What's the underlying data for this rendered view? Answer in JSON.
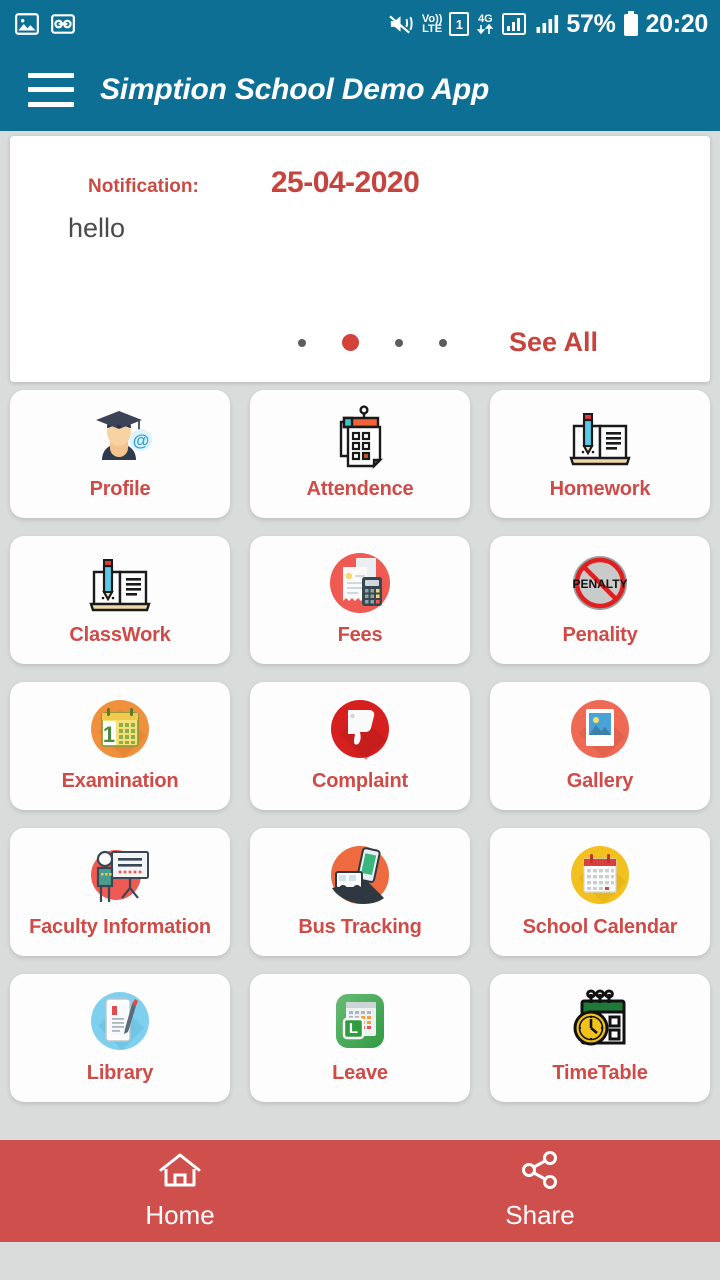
{
  "statusbar": {
    "left_icons": [
      "screenshot-icon",
      "voicemail-icon"
    ],
    "mute_icon": "mute-vibrate-icon",
    "volte_top": "Vo))",
    "volte_bottom": "LTE",
    "sim_label": "1",
    "network_type": "4G",
    "battery_percent": "57%",
    "time": "20:20"
  },
  "appbar": {
    "menu_icon": "hamburger-menu-icon",
    "title": "Simption School Demo App",
    "bg_color": "#0e6f94"
  },
  "notification": {
    "label": "Notification:",
    "date": "25-04-2020",
    "message": "hello",
    "see_all": "See All",
    "dots_count": 4,
    "active_dot_index": 1,
    "accent_color": "#c6443d"
  },
  "grid": {
    "label_color": "#cf4b47",
    "items": [
      {
        "label": "Profile",
        "icon": "graduate-avatar-icon"
      },
      {
        "label": "Attendence",
        "icon": "wall-calendar-checklist-icon"
      },
      {
        "label": "Homework",
        "icon": "book-pencil-icon"
      },
      {
        "label": "ClassWork",
        "icon": "book-pencil-icon"
      },
      {
        "label": "Fees",
        "icon": "invoice-calculator-icon"
      },
      {
        "label": "Penality",
        "icon": "penalty-prohibition-icon"
      },
      {
        "label": "Examination",
        "icon": "orange-calendar-icon"
      },
      {
        "label": "Complaint",
        "icon": "thumbs-down-icon"
      },
      {
        "label": "Gallery",
        "icon": "photo-picture-icon"
      },
      {
        "label": "Faculty Information",
        "icon": "teacher-whiteboard-icon"
      },
      {
        "label": "Bus Tracking",
        "icon": "bus-phone-tracking-icon"
      },
      {
        "label": "School Calendar",
        "icon": "yellow-calendar-icon"
      },
      {
        "label": "Library",
        "icon": "tablet-pen-icon"
      },
      {
        "label": "Leave",
        "icon": "leave-app-icon"
      },
      {
        "label": "TimeTable",
        "icon": "clock-calendar-icon"
      }
    ]
  },
  "bottombar": {
    "bg_color": "#cf4f4c",
    "items": [
      {
        "label": "Home",
        "icon": "home-icon"
      },
      {
        "label": "Share",
        "icon": "share-icon"
      }
    ]
  }
}
